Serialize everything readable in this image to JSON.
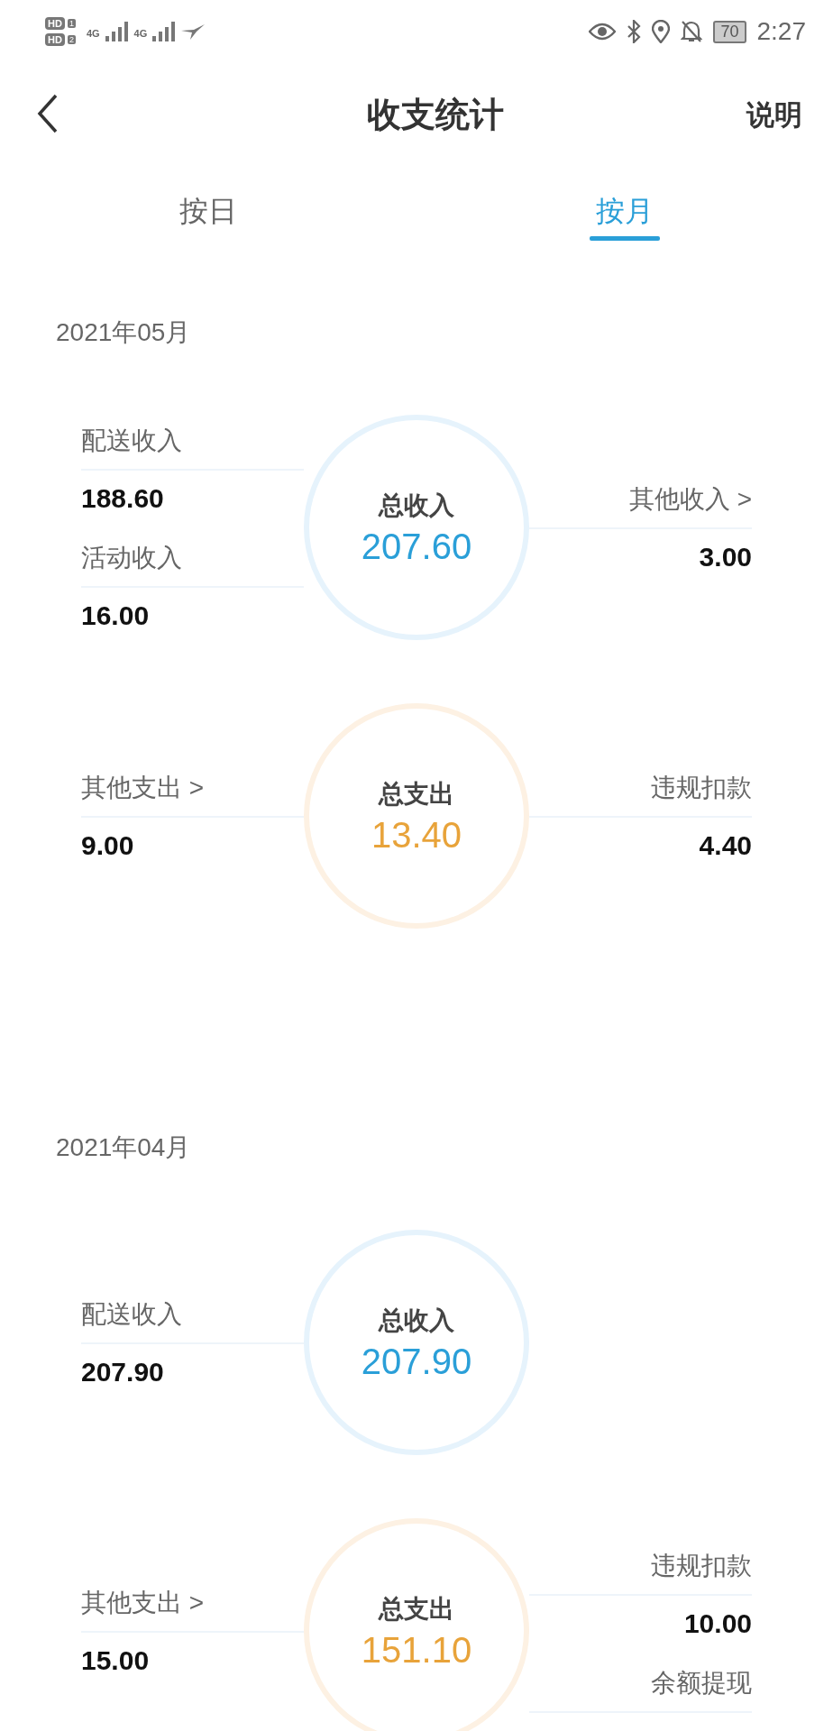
{
  "status_bar": {
    "sims": [
      {
        "badge": "HD",
        "slot": "1",
        "network": "4G"
      },
      {
        "badge": "HD",
        "slot": "2",
        "network": "4G"
      }
    ],
    "battery": "70",
    "time": "2:27"
  },
  "header": {
    "title": "收支统计",
    "action": "说明"
  },
  "tabs": [
    {
      "label": "按日",
      "selected": false
    },
    {
      "label": "按月",
      "selected": true
    }
  ],
  "months": [
    {
      "month": "2021年05月",
      "groups": [
        {
          "kind": "income",
          "title": "总收入",
          "total": "207.60",
          "left": [
            {
              "label": "配送收入",
              "value": "188.60"
            },
            {
              "label": "活动收入",
              "value": "16.00"
            }
          ],
          "right": [
            {
              "label": "其他收入 >",
              "value": "3.00"
            }
          ]
        },
        {
          "kind": "expense",
          "title": "总支出",
          "total": "13.40",
          "left": [
            {
              "label": "其他支出 >",
              "value": "9.00"
            }
          ],
          "right": [
            {
              "label": "违规扣款",
              "value": "4.40"
            }
          ]
        }
      ]
    },
    {
      "month": "2021年04月",
      "groups": [
        {
          "kind": "income",
          "title": "总收入",
          "total": "207.90",
          "left": [
            {
              "label": "配送收入",
              "value": "207.90"
            }
          ]
        },
        {
          "kind": "expense",
          "title": "总支出",
          "total": "151.10",
          "left": [
            {
              "label": "其他支出 >",
              "value": "15.00"
            }
          ],
          "right": [
            {
              "label": "违规扣款",
              "value": "10.00"
            },
            {
              "label": "余额提现"
            }
          ]
        }
      ]
    }
  ]
}
